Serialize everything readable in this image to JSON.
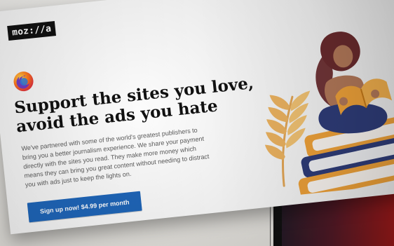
{
  "brand": {
    "logo_text": "moz://a",
    "firefox_icon": "firefox-icon"
  },
  "hero": {
    "headline_lines": [
      "Support the sites you love,",
      "avoid the ads you hate"
    ],
    "body_lines": [
      "We've partnered with some of the world's greatest publishers to",
      "bring you a better journalism experience. We share your payment",
      "directly with the sites you read. They make more money which",
      "means they can bring you great content without needing to distract",
      "you with ads just to keep the lights on."
    ],
    "cta_label": "Sign up now! $4.99 per month"
  },
  "illustration": {
    "icon": "reading-person-on-books-illustration"
  },
  "colors": {
    "cta_blue": "#1f66b9",
    "book_orange": "#f2a43a",
    "book_navy": "#2f3d7a",
    "skin": "#b57a5a",
    "hair": "#6b2b2e",
    "leaf": "#f0b35a"
  }
}
